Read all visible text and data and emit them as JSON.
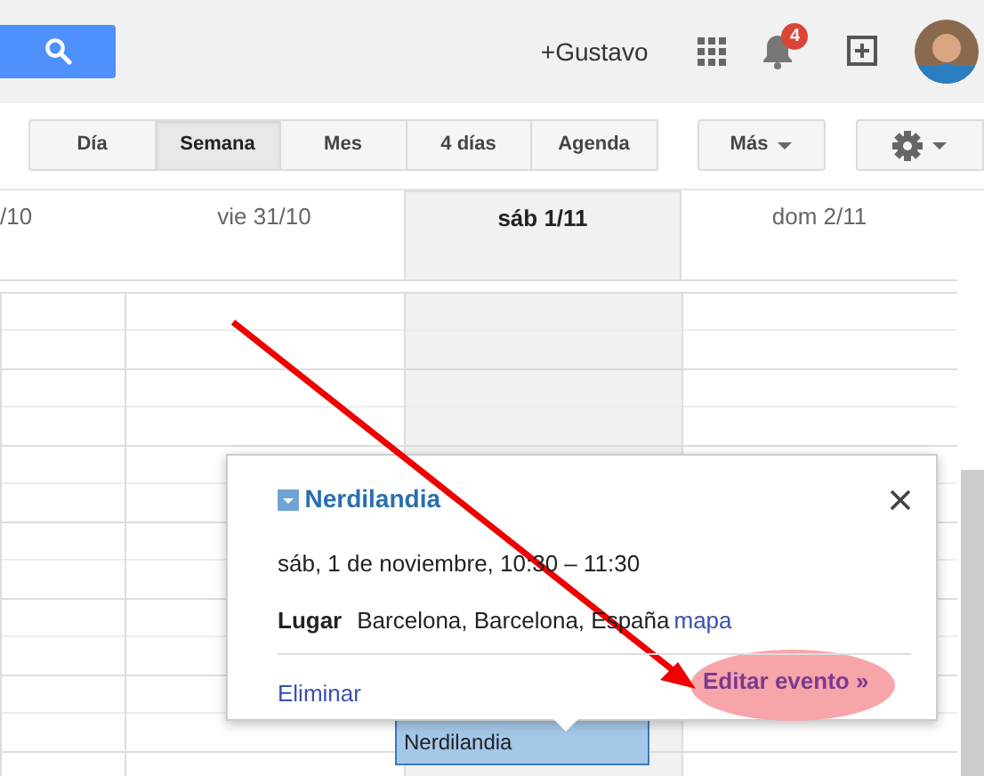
{
  "header": {
    "user": "+Gustavo",
    "notifications": "4"
  },
  "views": [
    {
      "label": "Día",
      "selected": false
    },
    {
      "label": "Semana",
      "selected": true
    },
    {
      "label": "Mes",
      "selected": false
    },
    {
      "label": "4 días",
      "selected": false
    },
    {
      "label": "Agenda",
      "selected": false
    }
  ],
  "more": "Más",
  "days": [
    {
      "label": "/10",
      "selected": false
    },
    {
      "label": "vie 31/10",
      "selected": false
    },
    {
      "label": "sáb 1/11",
      "selected": true
    },
    {
      "label": "dom 2/11",
      "selected": false
    }
  ],
  "event_block": {
    "title": "Nerdilandia"
  },
  "popup": {
    "title": "Nerdilandia",
    "when": "sáb, 1 de noviembre, 10:30 – 11:30",
    "place_label": "Lugar",
    "place": "Barcelona, Barcelona, España",
    "map_link": "mapa",
    "delete": "Eliminar",
    "edit": "Editar evento »"
  }
}
